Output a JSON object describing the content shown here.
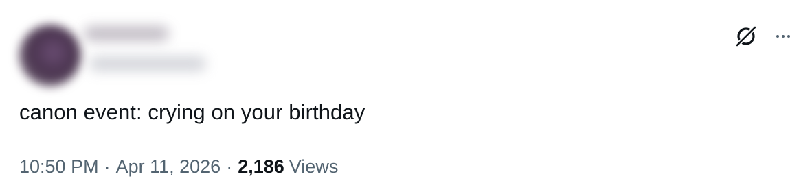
{
  "tweet": {
    "text": "canon event: crying on your birthday",
    "time": "10:50 PM",
    "date": "Apr 11, 2026",
    "separator": "·",
    "views_count": "2,186",
    "views_label": "Views"
  },
  "icons": {
    "grok": "grok-icon",
    "more": "more-icon"
  },
  "colors": {
    "text_primary": "#0f1419",
    "text_secondary": "#536471",
    "background": "#ffffff"
  }
}
